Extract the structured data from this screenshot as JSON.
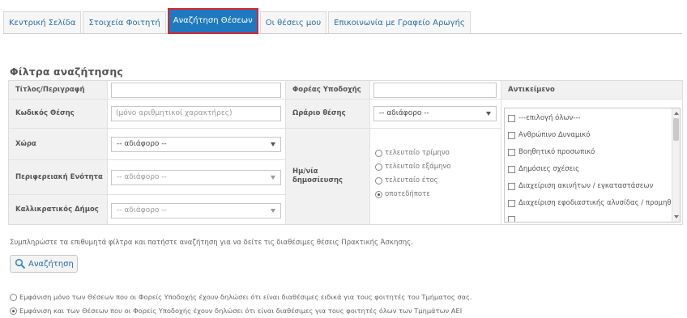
{
  "tabs": [
    {
      "label": "Κεντρική Σελίδα",
      "active": false
    },
    {
      "label": "Στοιχεία Φοιτητή",
      "active": false
    },
    {
      "label": "Αναζήτηση Θέσεων",
      "active": true
    },
    {
      "label": "Οι θέσεις μου",
      "active": false
    },
    {
      "label": "Επικοινωνία με Γραφείο Αρωγής",
      "active": false
    }
  ],
  "page_title": "Φίλτρα αναζήτησης",
  "filters": {
    "title_label": "Τίτλος/Περιγραφή",
    "title_value": "",
    "code_label": "Κωδικός Θέσης",
    "code_placeholder": "(μόνο αριθμητικοί χαρακτήρες)",
    "country_label": "Χώρα",
    "country_value": "-- αδιάφορο --",
    "region_label": "Περιφερειακή Ενότητα",
    "region_value": "-- αδιάφορο --",
    "municipality_label": "Καλλικρατικός Δήμος",
    "municipality_value": "-- αδιάφορο --",
    "host_label": "Φορέας Υποδοχής",
    "host_value": "",
    "schedule_label": "Ωράριο θέσης",
    "schedule_value": "-- αδιάφορο --",
    "date_label": "Ημ/νία δημοσίευσης",
    "date_options": [
      "τελευταίο τρίμηνο",
      "τελευταίο εξάμηνο",
      "τελευταίο έτος",
      "οποτεδήποτε"
    ],
    "date_selected": 3,
    "subject_label": "Αντικείμενο",
    "subject_items": [
      "---επιλογή όλων---",
      "Ανθρώπινο Δυναμικό",
      "Βοηθητικό προσωπικό",
      "Δημόσιες σχέσεις",
      "Διαχείριση ακινήτων / εγκαταστάσεων",
      "Διαχείριση εφοδιαστικής αλυσίδας / προμηθειών"
    ]
  },
  "instructions": "Συμπληρώστε τα επιθυμητά φίλτρα και πατήστε αναζήτηση για να δείτε τις διαθέσιμες θέσεις Πρακτικής Άσκησης.",
  "search_button": "Αναζήτηση",
  "display_options": [
    "Εμφάνιση μόνο των Θέσεων που οι Φορείς Υποδοχής έχουν δηλώσει ότι είναι διαθέσιμες ειδικά για τους φοιτητές του Τμήματος σας.",
    "Εμφάνιση και των Θέσεων που οι Φορείς Υποδοχής έχουν δηλώσει ότι είναι διαθέσιμες για τους φοιτητές όλων των Τμημάτων ΑΕΙ"
  ],
  "display_selected": 1,
  "colors": {
    "active_tab": "#1f79c0",
    "active_tab_border": "#d7262e",
    "link": "#2a6ea6"
  }
}
